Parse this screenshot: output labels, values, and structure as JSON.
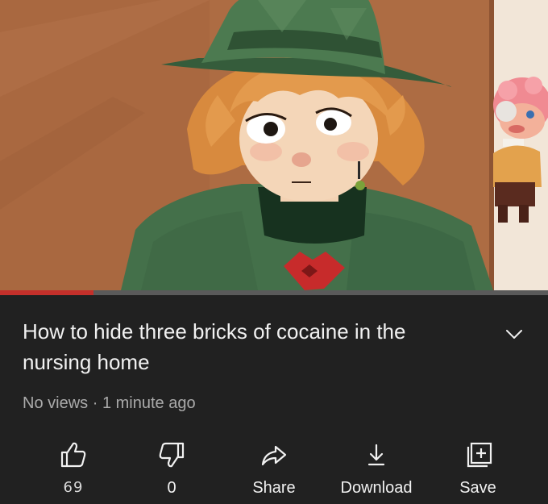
{
  "video": {
    "title": "How to hide three bricks of cocaine in the nursing home",
    "progress_fraction": 0.17
  },
  "meta": {
    "views": "No views",
    "separator": "·",
    "age": "1 minute ago"
  },
  "actions": [
    {
      "name": "like",
      "icon": "thumbs-up-icon",
      "label": "69"
    },
    {
      "name": "dislike",
      "icon": "thumbs-down-icon",
      "label": "0"
    },
    {
      "name": "share",
      "icon": "share-arrow-icon",
      "label": "Share"
    },
    {
      "name": "download",
      "icon": "download-icon",
      "label": "Download"
    },
    {
      "name": "save",
      "icon": "save-to-playlist-icon",
      "label": "Save"
    }
  ],
  "colors": {
    "background": "#212121",
    "text": "#f1f1f1",
    "secondary_text": "#aaaaaa",
    "progress": "#c4302b"
  }
}
